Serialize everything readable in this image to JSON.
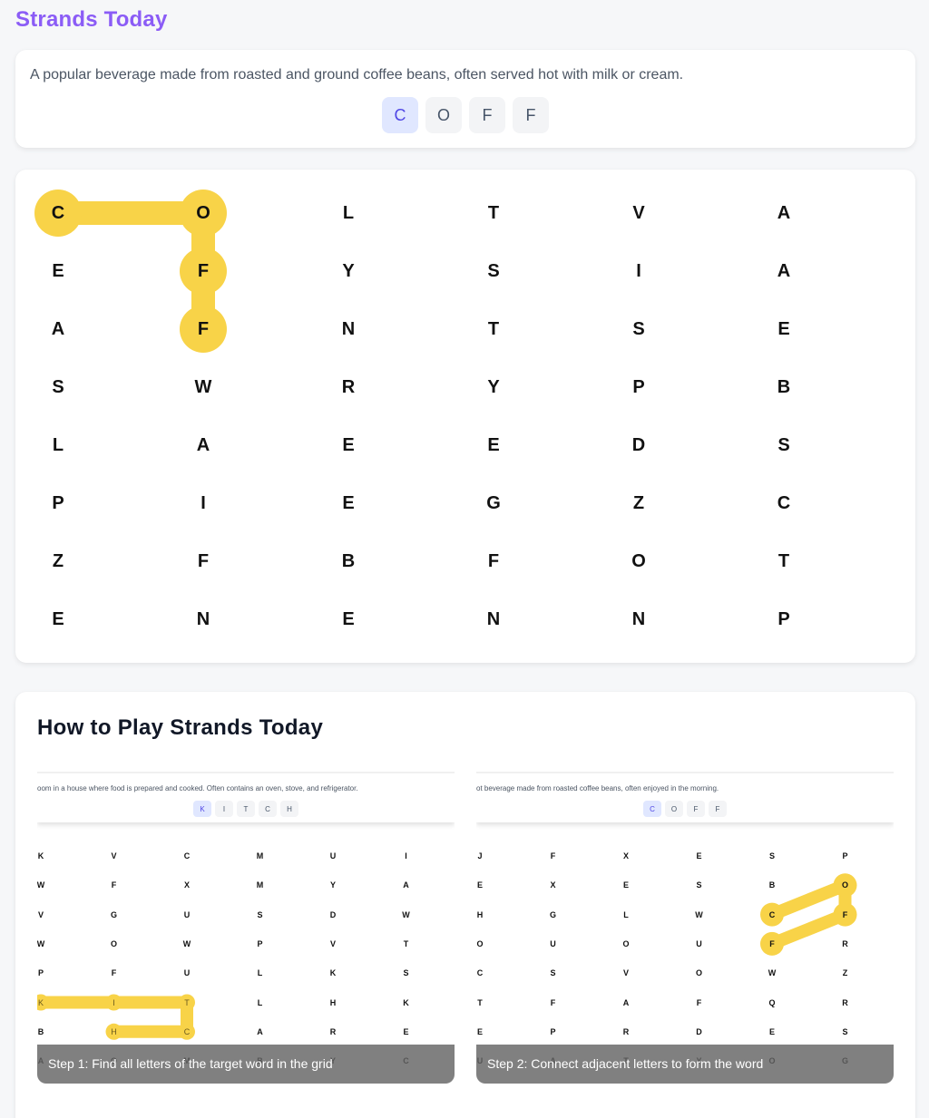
{
  "site": {
    "title": "Strands Today"
  },
  "clue": {
    "text": "A popular beverage made from roasted and ground coffee beans, often served hot with milk or cream.",
    "found_letters": [
      "C",
      "O",
      "F",
      "F"
    ]
  },
  "grid": {
    "rows": [
      [
        "C",
        "O",
        "L",
        "T",
        "V",
        "A"
      ],
      [
        "E",
        "F",
        "Y",
        "S",
        "I",
        "A"
      ],
      [
        "A",
        "F",
        "N",
        "T",
        "S",
        "E"
      ],
      [
        "S",
        "W",
        "R",
        "Y",
        "P",
        "B"
      ],
      [
        "L",
        "A",
        "E",
        "E",
        "D",
        "S"
      ],
      [
        "P",
        "I",
        "E",
        "G",
        "Z",
        "C"
      ],
      [
        "Z",
        "F",
        "B",
        "F",
        "O",
        "T"
      ],
      [
        "E",
        "N",
        "E",
        "N",
        "N",
        "P"
      ]
    ],
    "selected_path": [
      [
        0,
        0
      ],
      [
        0,
        1
      ],
      [
        1,
        1
      ],
      [
        2,
        1
      ]
    ],
    "highlight_color": "#f8d348"
  },
  "how_to_play": {
    "title": "How to Play Strands Today",
    "examples": [
      {
        "clue_text": "oom in a house where food is prepared and cooked. Often contains an oven, stove, and refrigerator.",
        "slots": [
          "K",
          "I",
          "T",
          "C",
          "H"
        ],
        "grid": [
          [
            "K",
            "V",
            "C",
            "M",
            "U",
            "I"
          ],
          [
            "W",
            "F",
            "X",
            "M",
            "Y",
            "A"
          ],
          [
            "V",
            "G",
            "U",
            "S",
            "D",
            "W"
          ],
          [
            "W",
            "O",
            "W",
            "P",
            "V",
            "T"
          ],
          [
            "P",
            "F",
            "U",
            "L",
            "K",
            "S"
          ],
          [
            "K",
            "I",
            "T",
            "L",
            "H",
            "K"
          ],
          [
            "B",
            "H",
            "C",
            "A",
            "R",
            "E"
          ],
          [
            "A",
            "O",
            "M",
            "B",
            "Y",
            "C"
          ]
        ],
        "path": [
          [
            5,
            0
          ],
          [
            5,
            1
          ],
          [
            5,
            2
          ],
          [
            6,
            2
          ],
          [
            6,
            1
          ]
        ],
        "caption": "Step 1: Find all letters of the target word in the grid"
      },
      {
        "clue_text": "ot beverage made from roasted coffee beans, often enjoyed in the morning.",
        "slots": [
          "C",
          "O",
          "F",
          "F"
        ],
        "grid": [
          [
            "J",
            "F",
            "X",
            "E",
            "S",
            "P"
          ],
          [
            "E",
            "X",
            "E",
            "S",
            "B",
            "O"
          ],
          [
            "H",
            "G",
            "L",
            "W",
            "C",
            "F"
          ],
          [
            "O",
            "U",
            "O",
            "U",
            "F",
            "R"
          ],
          [
            "C",
            "S",
            "V",
            "O",
            "W",
            "Z"
          ],
          [
            "T",
            "F",
            "A",
            "F",
            "Q",
            "R"
          ],
          [
            "E",
            "P",
            "R",
            "D",
            "E",
            "S"
          ],
          [
            "U",
            "A",
            "T",
            "Y",
            "O",
            "G"
          ]
        ],
        "path": [
          [
            2,
            4
          ],
          [
            1,
            5
          ],
          [
            2,
            5
          ],
          [
            3,
            4
          ]
        ],
        "caption": "Step 2: Connect adjacent letters to form the word"
      }
    ]
  }
}
